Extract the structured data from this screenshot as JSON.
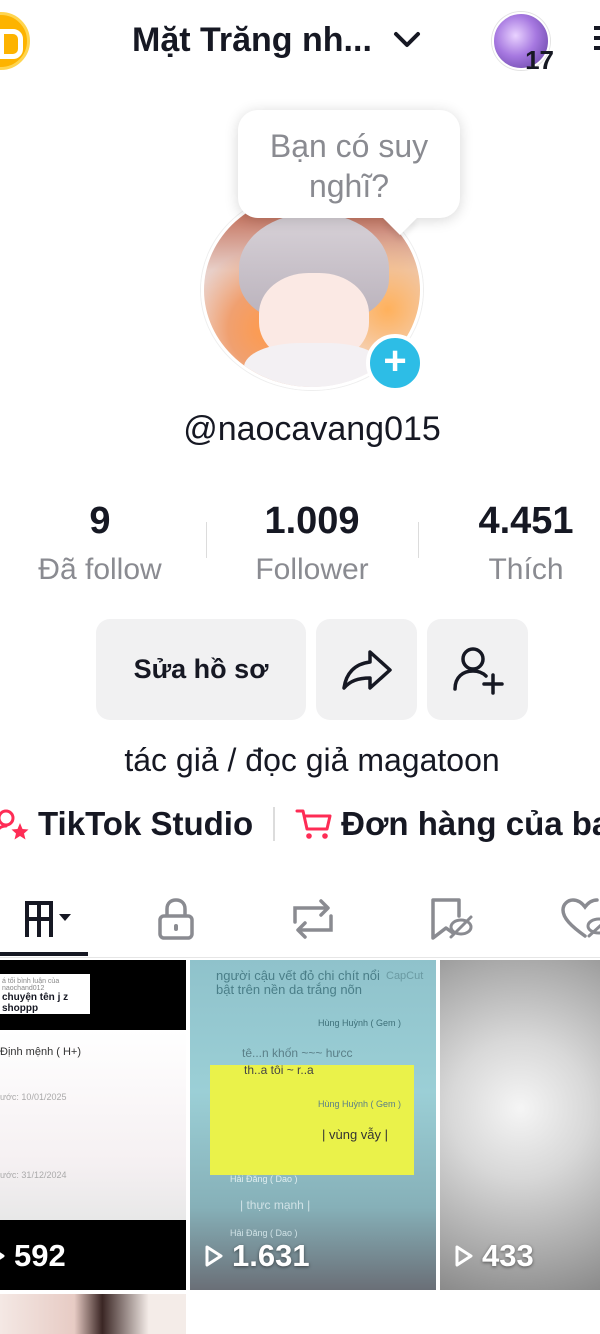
{
  "header": {
    "title": "Mặt Trăng nh...",
    "notification_count": "17",
    "icons": [
      "coin-icon",
      "chevron-down-icon",
      "menu-icon"
    ]
  },
  "profile": {
    "bubble_text": "Bạn có suy nghĩ?",
    "username": "@naocavang015",
    "bio": "tác giả / đọc giả magatoon"
  },
  "stats": [
    {
      "value": "9",
      "label": "Đã follow"
    },
    {
      "value": "1.009",
      "label": "Follower"
    },
    {
      "value": "4.451",
      "label": "Thích"
    }
  ],
  "buttons": {
    "edit_profile": "Sửa hồ sơ"
  },
  "links": {
    "studio": "TikTok Studio",
    "orders": "Đơn hàng của ba"
  },
  "tabs": [
    "videos-grid-icon",
    "lock-icon",
    "repost-icon",
    "saved-icon",
    "liked-icon"
  ],
  "videos": [
    {
      "views": "592"
    },
    {
      "views": "1.631"
    },
    {
      "views": "433"
    }
  ],
  "video_overlay_text": {
    "v1_lines": [
      "á tối bình luận của",
      "naochand012",
      "chuyện tên j z",
      "shoppp",
      "Định mệnh ( H+)",
      "ước: 10/01/2025",
      "ước: 31/12/2024"
    ],
    "v2_lines": [
      "người cậu vết đỏ chi chít nổi",
      "bật trên nền da trắng nõn",
      "CapCut",
      "Hùng Huỳnh ( Gem )",
      "tê...n khốn ~~~ hưcc",
      "th..a tôi ~ r..a",
      "Hùng Huỳnh ( Gem )",
      "| vùng vẫy |",
      "Hải Đăng ( Dao )",
      "| thực mạnh |",
      "Hải Đăng ( Dao )"
    ]
  },
  "colors": {
    "accent_pink": "#fe2c55",
    "plus_blue": "#2dbde6",
    "button_bg": "#f1f1f2",
    "muted_text": "#8a8b91"
  }
}
